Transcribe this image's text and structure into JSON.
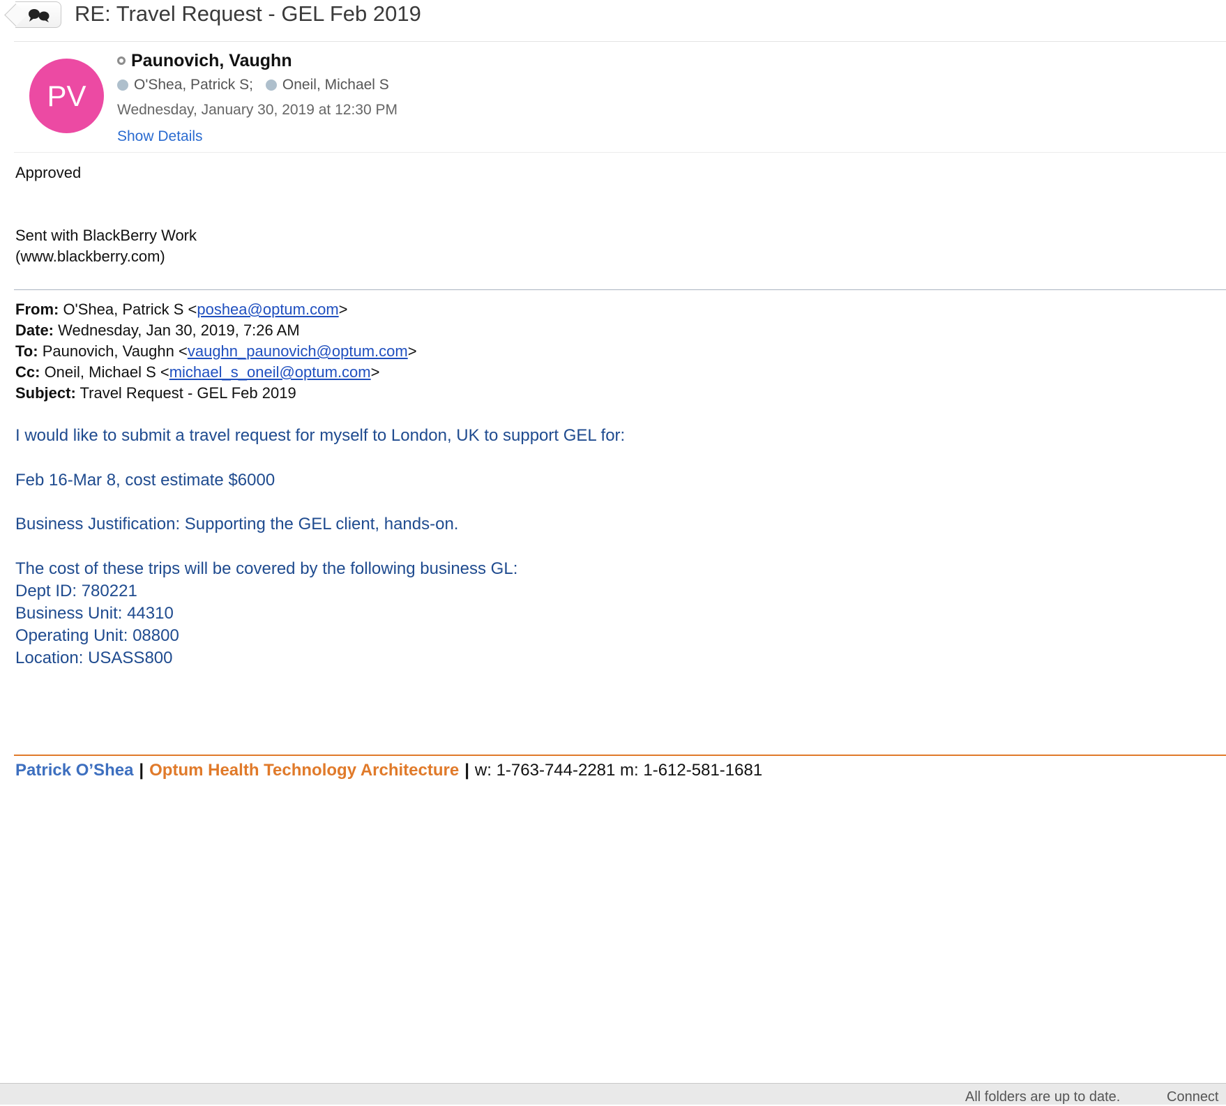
{
  "header": {
    "subject": "RE: Travel Request - GEL Feb 2019"
  },
  "sender": {
    "initials": "PV",
    "avatar_color": "#ec4aa3",
    "name": "Paunovich, Vaughn",
    "recipients": [
      "O'Shea, Patrick S;",
      "Oneil, Michael S"
    ],
    "date": "Wednesday, January 30, 2019 at 12:30 PM",
    "show_details_label": "Show Details"
  },
  "reply": {
    "text": "Approved",
    "footer_line1": "Sent with BlackBerry Work",
    "footer_line2": "(www.blackberry.com)"
  },
  "quoted_header": {
    "from_label": "From:",
    "from_name": " O'Shea, Patrick S <",
    "from_email": "poshea@optum.com",
    "date_label": "Date:",
    "date_value": " Wednesday, Jan 30, 2019, 7:26 AM",
    "to_label": "To:",
    "to_name": " Paunovich, Vaughn <",
    "to_email": "vaughn_paunovich@optum.com",
    "cc_label": "Cc:",
    "cc_name": " Oneil, Michael S <",
    "cc_email": "michael_s_oneil@optum.com",
    "subject_label": "Subject:",
    "subject_value": " Travel Request - GEL Feb 2019",
    "close_angle": ">"
  },
  "quoted_body": {
    "line1": "I would like to submit a travel request for myself to London, UK to support GEL for:",
    "line2": "Feb 16-Mar 8, cost estimate $6000",
    "line3": "Business Justification:  Supporting the GEL client, hands-on.",
    "line4": "The cost of these trips will be covered by the following business GL:",
    "line5": "Dept ID: 780221",
    "line6": "Business Unit:  44310",
    "line7": "Operating Unit:  08800",
    "line8": "Location:  USASS800"
  },
  "signature": {
    "name": "Patrick O’Shea",
    "separator": "|",
    "department": "Optum Health Technology Architecture",
    "phones": "w: 1-763-744-2281 m: 1-612-581-1681"
  },
  "status_bar": {
    "folders": "All folders are up to date.",
    "connection": "Connect"
  }
}
